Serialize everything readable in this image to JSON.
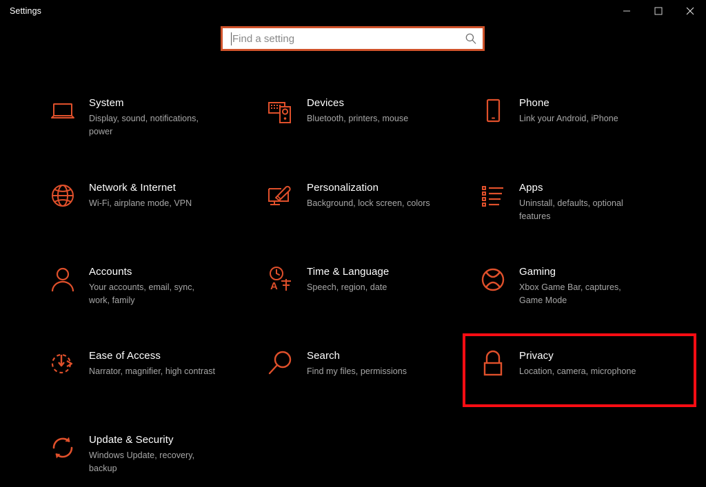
{
  "window": {
    "title": "Settings",
    "controls": [
      {
        "name": "minimize",
        "label": "Minimize"
      },
      {
        "name": "maximize",
        "label": "Maximize"
      },
      {
        "name": "close",
        "label": "Close"
      }
    ]
  },
  "search": {
    "placeholder": "Find a setting",
    "value": "",
    "icon": "search-icon",
    "border_color": "#d0532b",
    "focused": true
  },
  "theme": {
    "background": "#000000",
    "accent_icon_color": "#e0502b",
    "title_text_color": "#ffffff",
    "desc_text_color": "#a8a8a8",
    "highlight_color": "#fb0c13"
  },
  "annotation": {
    "target": "Privacy",
    "color": "#fb0c13"
  },
  "settings": {
    "rows": [
      [
        {
          "id": "system",
          "icon": "laptop-icon",
          "title": "System",
          "desc": "Display, sound, notifications, power"
        },
        {
          "id": "devices",
          "icon": "devices-icon",
          "title": "Devices",
          "desc": "Bluetooth, printers, mouse"
        },
        {
          "id": "phone",
          "icon": "phone-icon",
          "title": "Phone",
          "desc": "Link your Android, iPhone"
        }
      ],
      [
        {
          "id": "network-internet",
          "icon": "globe-icon",
          "title": "Network & Internet",
          "desc": "Wi-Fi, airplane mode, VPN"
        },
        {
          "id": "personalization",
          "icon": "monitor-brush-icon",
          "title": "Personalization",
          "desc": "Background, lock screen, colors"
        },
        {
          "id": "apps",
          "icon": "list-icon",
          "title": "Apps",
          "desc": "Uninstall, defaults, optional features"
        }
      ],
      [
        {
          "id": "accounts",
          "icon": "person-icon",
          "title": "Accounts",
          "desc": "Your accounts, email, sync, work, family"
        },
        {
          "id": "time-language",
          "icon": "clock-language-icon",
          "title": "Time & Language",
          "desc": "Speech, region, date"
        },
        {
          "id": "gaming",
          "icon": "xbox-icon",
          "title": "Gaming",
          "desc": "Xbox Game Bar, captures, Game Mode"
        }
      ],
      [
        {
          "id": "ease-of-access",
          "icon": "accessibility-clock-icon",
          "title": "Ease of Access",
          "desc": "Narrator, magnifier, high contrast"
        },
        {
          "id": "search",
          "icon": "magnifier-icon",
          "title": "Search",
          "desc": "Find my files, permissions"
        },
        {
          "id": "privacy",
          "icon": "lock-icon",
          "title": "Privacy",
          "desc": "Location, camera, microphone",
          "highlighted": true
        }
      ],
      [
        {
          "id": "update-security",
          "icon": "refresh-icon",
          "title": "Update & Security",
          "desc": "Windows Update, recovery, backup"
        }
      ]
    ]
  }
}
